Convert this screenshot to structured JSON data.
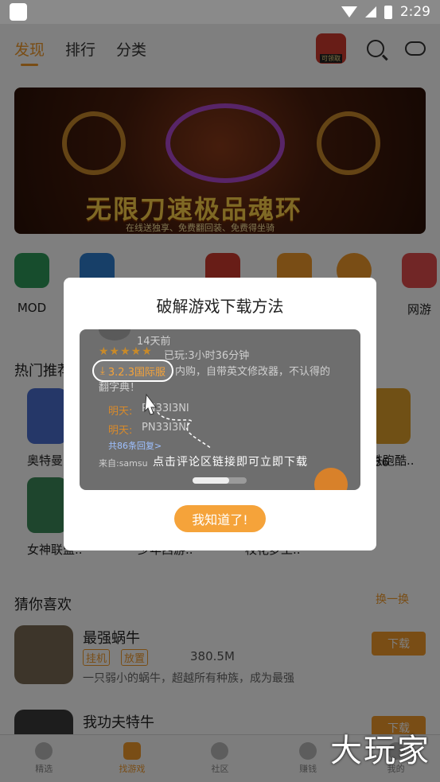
{
  "status_bar": {
    "time": "2:29"
  },
  "top_nav": {
    "tabs": [
      "发现",
      "排行",
      "分类"
    ],
    "gift_label": "可领取"
  },
  "banner": {
    "title": "无限刀速极品魂环",
    "subtitle": "在线送独享、免费翻回装、免费得坐骑"
  },
  "categories": [
    {
      "label": "MOD",
      "color": "#2e9a5a"
    },
    {
      "label": "",
      "color": "#2f7fd1"
    },
    {
      "label": "",
      "color": "#d13b2e"
    },
    {
      "label": "",
      "color": "#f39a2a"
    },
    {
      "label": "",
      "color": "#f39a2a"
    },
    {
      "label": "网游",
      "color": "#e24d4d"
    }
  ],
  "hot": {
    "title": "热门推荐",
    "apps": [
      {
        "name": "奥特曼",
        "color": "#4a6fd1"
      },
      {
        "name": "女神联盟..",
        "color": "#3c8a5a"
      },
      {
        "name": "少年西游..",
        "color": "#8a5a3a"
      },
      {
        "name": "校花梦工..",
        "color": "#c97aa0"
      },
      {
        "name": "铁跑酷..",
        "color": "#e0a02a"
      }
    ],
    "extra_count": "36"
  },
  "guess": {
    "title": "猜你喜欢",
    "refresh": "换一换",
    "items": [
      {
        "name": "最强蜗牛",
        "tags": [
          "挂机",
          "放置"
        ],
        "size": "380.5M",
        "desc": "一只弱小的蜗牛，超越所有种族，成为最强",
        "button": "下载"
      },
      {
        "name": "我功夫特牛",
        "tags": [],
        "size": "",
        "desc": "",
        "button": "下载"
      }
    ]
  },
  "bottom_nav": [
    "精选",
    "找游戏",
    "社区",
    "赚钱",
    "我的"
  ],
  "watermark": "大玩家",
  "modal": {
    "title": "破解游戏下载方法",
    "demo": {
      "time_ago": "14天前",
      "played": "已玩:3小时36分钟",
      "pill": "3.2.3国际服",
      "comment": "内购，自带英文修改器，不认得的",
      "comment_2": "翻字典！",
      "reply_name": "明天:",
      "reply_1": "PN33I3NI",
      "reply_2": "PN33I3NI",
      "reply_count": "共86条回复>",
      "source": "来自:samsu",
      "caption": "点击评论区链接即可立即下载"
    },
    "button": "我知道了!"
  }
}
